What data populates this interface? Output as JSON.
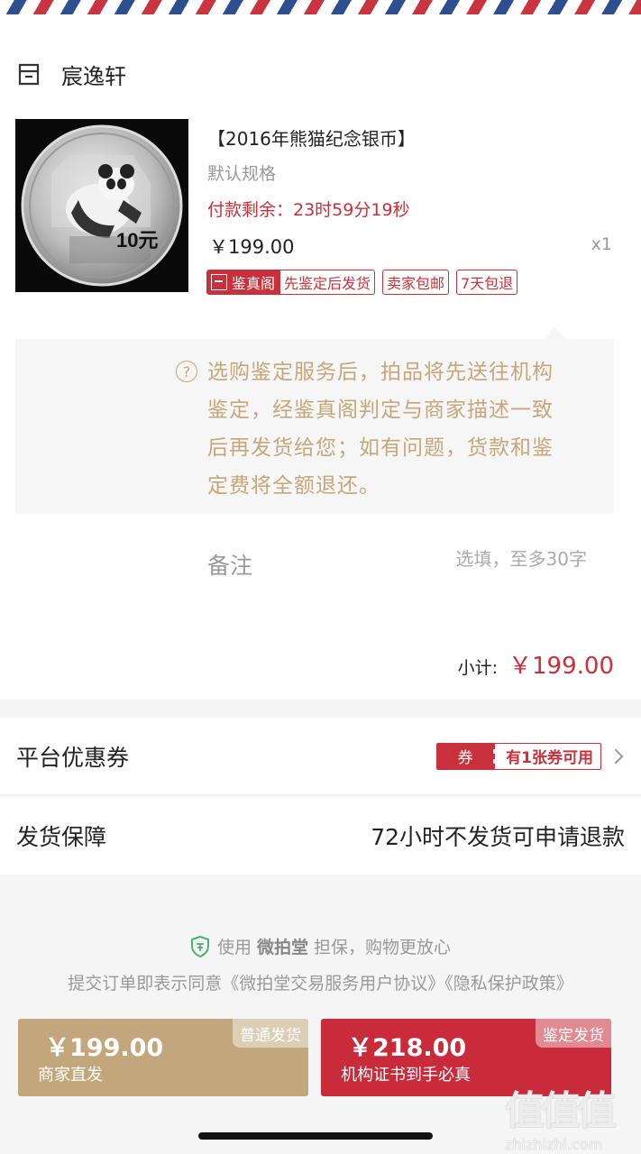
{
  "shop": {
    "name": "宸逸轩",
    "icon": "shop-icon"
  },
  "product": {
    "title": "【2016年熊猫纪念银币】",
    "spec": "默认规格",
    "timer": "付款剩余：23时59分19秒",
    "price": "￥199.00",
    "qty": "x1",
    "tags": {
      "auth_brand": "鉴真阁",
      "auth_label": "先鉴定后发货",
      "free_ship": "卖家包邮",
      "return": "7天包退"
    },
    "coin_value_label": "10元"
  },
  "tip": {
    "icon": "question-circle-icon",
    "text": "选购鉴定服务后，拍品将先送往机构鉴定，经鉴真阁判定与商家描述一致后再发货给您；如有问题，货款和鉴定费将全额退还。"
  },
  "note": {
    "label": "备注",
    "placeholder": "选填，至多30字"
  },
  "subtotal": {
    "label": "小计:",
    "value": "￥199.00"
  },
  "coupon": {
    "title": "平台优惠券",
    "badge": "券",
    "text": "有1张券可用"
  },
  "shipping": {
    "title": "发货保障",
    "value": "72小时不发货可申请退款"
  },
  "guarantee": {
    "prefix": "使用",
    "brand": "微拍堂",
    "suffix": "担保，购物更放心"
  },
  "agreement": "提交订单即表示同意《微拍堂交易服务用户协议》《隐私保护政策》",
  "buttons": {
    "normal": {
      "price": "￥199.00",
      "sub": "商家直发",
      "corner": "普通发货"
    },
    "auth": {
      "price": "￥218.00",
      "sub": "机构证书到手必真",
      "corner": "鉴定发货"
    }
  },
  "watermark": {
    "logo": "值值值",
    "url": "zhizhizhi.com"
  },
  "colors": {
    "accent_red": "#c8303c",
    "gold": "#c2a77d",
    "tip_text": "#c6a77b"
  }
}
